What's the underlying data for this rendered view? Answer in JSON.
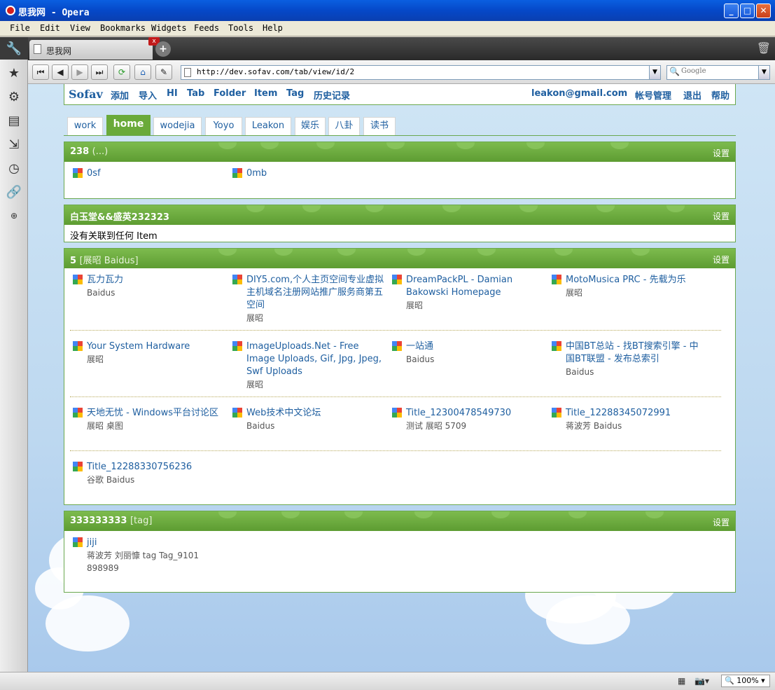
{
  "window": {
    "title": "思我网 - Opera"
  },
  "menu": [
    "File",
    "Edit",
    "View",
    "Bookmarks",
    "Widgets",
    "Feeds",
    "Tools",
    "Help"
  ],
  "tab": {
    "label": "思我网",
    "close": "x",
    "new": "+"
  },
  "address": {
    "url": "http://dev.sofav.com/tab/view/id/2",
    "search_placeholder": "Google"
  },
  "site_nav": {
    "logo": "Sofav",
    "links": [
      "添加",
      "导入",
      "HI",
      "Tab",
      "Folder",
      "Item",
      "Tag",
      "历史记录"
    ],
    "account": [
      "leakon@gmail.com",
      "帐号管理",
      "退出",
      "帮助"
    ]
  },
  "page_tabs": [
    "work",
    "home",
    "wodejia",
    "Yoyo",
    "Leakon",
    "娱乐",
    "八卦",
    "读书"
  ],
  "active_tab": "home",
  "settings_label": "设置",
  "folders": [
    {
      "title": "238",
      "sub": "(...)",
      "items": [
        {
          "title": "0sf",
          "meta": ""
        },
        {
          "title": "0mb",
          "meta": ""
        }
      ]
    },
    {
      "title": "白玉堂&&盛英232323",
      "sub": "",
      "empty_text": "没有关联到任何 Item",
      "items": []
    },
    {
      "title": "5",
      "sub": "[展昭 Baidus]",
      "items": [
        {
          "title": "瓦力瓦力",
          "meta": "Baidus"
        },
        {
          "title": "DIY5.com,个人主页空间专业虚拟主机域名注册网站推广服务商第五空间",
          "meta": "展昭"
        },
        {
          "title": "DreamPackPL - Damian Bakowski Homepage",
          "meta": "展昭"
        },
        {
          "title": "MotoMusica PRC - 先载为乐",
          "meta": "展昭"
        },
        {
          "title": "Your System Hardware",
          "meta": "展昭"
        },
        {
          "title": "ImageUploads.Net - Free Image Uploads, Gif, Jpg, Jpeg, Swf Uploads",
          "meta": "展昭"
        },
        {
          "title": "一站通",
          "meta": "Baidus"
        },
        {
          "title": "中国BT总站 - 找BT搜索引擎 - 中国BT联盟 - 发布总索引",
          "meta": "Baidus"
        },
        {
          "title": "天地无忧 - Windows平台讨论区",
          "meta": "展昭 桌图"
        },
        {
          "title": "Web技术中文论坛",
          "meta": "Baidus"
        },
        {
          "title": "Title_12300478549730",
          "meta": "测试 展昭 5709"
        },
        {
          "title": "Title_12288345072991",
          "meta": "蒋波芳 Baidus"
        },
        {
          "title": "Title_12288330756236",
          "meta": "谷歌 Baidus"
        }
      ]
    },
    {
      "title": "333333333",
      "sub": "[tag]",
      "items": [
        {
          "title": "jiji",
          "meta": "蒋波芳 刘丽慷 tag Tag_9101 898989"
        }
      ]
    }
  ],
  "status": {
    "zoom": "100%"
  }
}
